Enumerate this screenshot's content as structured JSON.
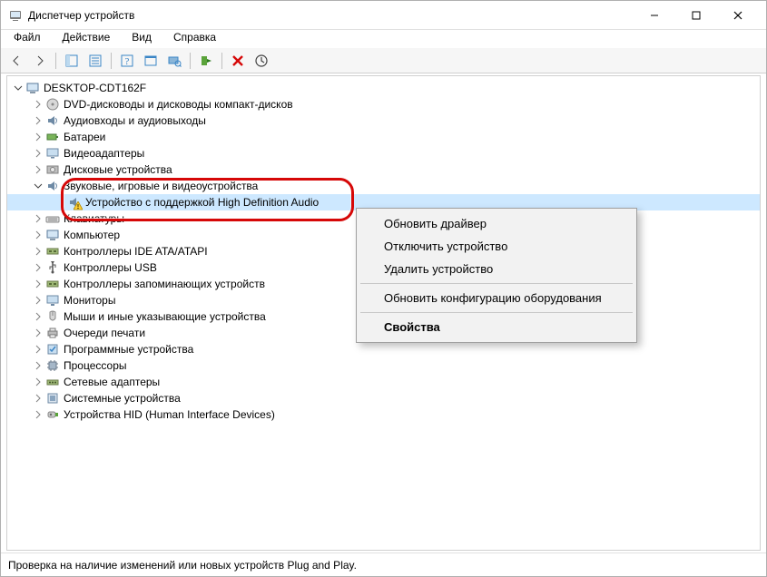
{
  "window": {
    "title": "Диспетчер устройств"
  },
  "menu": {
    "file": "Файл",
    "action": "Действие",
    "view": "Вид",
    "help": "Справка"
  },
  "tree": {
    "root": "DESKTOP-CDT162F",
    "items": [
      {
        "label": "DVD-дисководы и дисководы компакт-дисков",
        "icon": "dvd"
      },
      {
        "label": "Аудиовходы и аудиовыходы",
        "icon": "audio"
      },
      {
        "label": "Батареи",
        "icon": "battery"
      },
      {
        "label": "Видеоадаптеры",
        "icon": "display"
      },
      {
        "label": "Дисковые устройства",
        "icon": "disk"
      }
    ],
    "audio_section": {
      "label": "Звуковые, игровые и видеоустройства",
      "child": "Устройство с поддержкой High Definition Audio"
    },
    "after": [
      {
        "label": "Клавиатуры",
        "icon": "keyboard"
      },
      {
        "label": "Компьютер",
        "icon": "computer"
      },
      {
        "label": "Контроллеры IDE ATA/ATAPI",
        "icon": "controller"
      },
      {
        "label": "Контроллеры USB",
        "icon": "usb"
      },
      {
        "label": "Контроллеры запоминающих устройств",
        "icon": "controller"
      },
      {
        "label": "Мониторы",
        "icon": "monitor"
      },
      {
        "label": "Мыши и иные указывающие устройства",
        "icon": "mouse"
      },
      {
        "label": "Очереди печати",
        "icon": "printer"
      },
      {
        "label": "Программные устройства",
        "icon": "soft"
      },
      {
        "label": "Процессоры",
        "icon": "cpu"
      },
      {
        "label": "Сетевые адаптеры",
        "icon": "network"
      },
      {
        "label": "Системные устройства",
        "icon": "system"
      },
      {
        "label": "Устройства HID (Human Interface Devices)",
        "icon": "hid"
      }
    ]
  },
  "contextmenu": {
    "update": "Обновить драйвер",
    "disable": "Отключить устройство",
    "delete": "Удалить устройство",
    "scan": "Обновить конфигурацию оборудования",
    "props": "Свойства"
  },
  "status": "Проверка на наличие изменений или новых устройств Plug and Play."
}
